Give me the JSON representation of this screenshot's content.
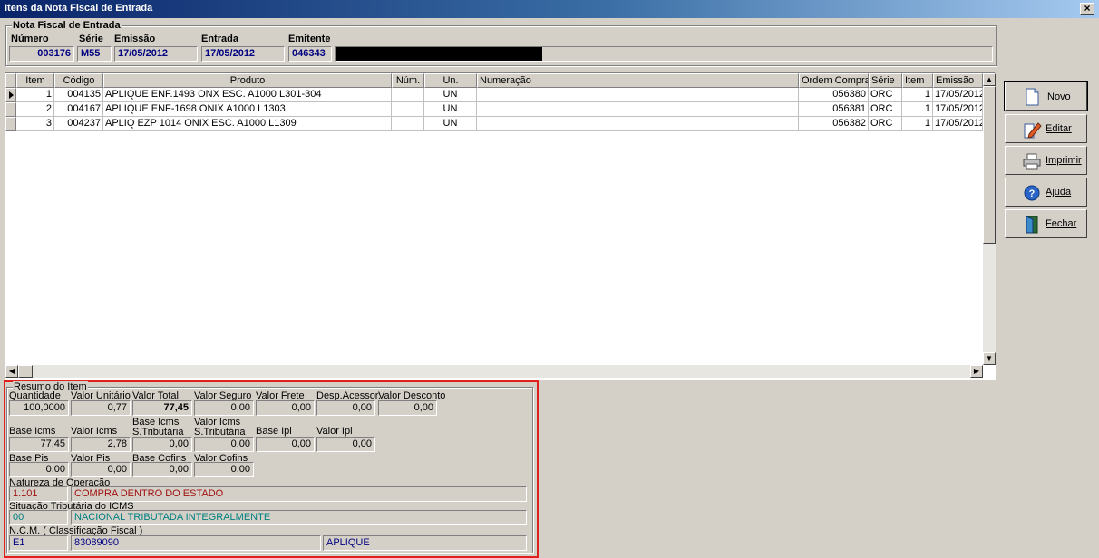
{
  "window": {
    "title": "Itens da Nota Fiscal de Entrada",
    "close_glyph": "×"
  },
  "nf": {
    "group_title": "Nota Fiscal de Entrada",
    "labels": {
      "numero": "Número",
      "serie": "Série",
      "emissao": "Emissão",
      "entrada": "Entrada",
      "emitente": "Emitente"
    },
    "values": {
      "numero": "003176",
      "serie": "M55",
      "emissao": "17/05/2012",
      "entrada": "17/05/2012",
      "emitente": "046343"
    }
  },
  "grid": {
    "columns": [
      "Item",
      "Código",
      "Produto",
      "Núm.",
      "Un.",
      "Numeração",
      "Ordem Compra",
      "Série",
      "Item",
      "Emissão"
    ],
    "rows": [
      {
        "item": "1",
        "codigo": "004135",
        "produto": "APLIQUE ENF.1493 ONX ESC. A1000 L301-304",
        "num": "",
        "un": "UN",
        "numeracao": "",
        "ordem": "056380",
        "serie": "ORC",
        "item2": "1",
        "emissao": "17/05/2012"
      },
      {
        "item": "2",
        "codigo": "004167",
        "produto": "APLIQUE ENF-1698 ONIX A1000 L1303",
        "num": "",
        "un": "UN",
        "numeracao": "",
        "ordem": "056381",
        "serie": "ORC",
        "item2": "1",
        "emissao": "17/05/2012"
      },
      {
        "item": "3",
        "codigo": "004237",
        "produto": "APLIQ EZP 1014 ONIX ESC. A1000 L1309",
        "num": "",
        "un": "UN",
        "numeracao": "",
        "ordem": "056382",
        "serie": "ORC",
        "item2": "1",
        "emissao": "17/05/2012"
      }
    ]
  },
  "buttons": {
    "novo": "Novo",
    "editar": "Editar",
    "imprimir": "Imprimir",
    "ajuda": "Ajuda",
    "fechar": "Fechar"
  },
  "resumo": {
    "title": "Resumo do Item",
    "quantidade": {
      "label": "Quantidade",
      "value": "100,0000"
    },
    "valor_unitario": {
      "label": "Valor Unitário",
      "value": "0,77"
    },
    "valor_total": {
      "label": "Valor Total",
      "value": "77,45"
    },
    "valor_seguro": {
      "label": "Valor Seguro",
      "value": "0,00"
    },
    "valor_frete": {
      "label": "Valor Frete",
      "value": "0,00"
    },
    "desp_acessor": {
      "label": "Desp.Acessor.",
      "value": "0,00"
    },
    "valor_desconto": {
      "label": "Valor Desconto",
      "value": "0,00"
    },
    "base_icms": {
      "label": "Base Icms",
      "value": "77,45"
    },
    "valor_icms": {
      "label": "Valor Icms",
      "value": "2,78"
    },
    "base_icms_st": {
      "label1": "Base Icms",
      "label2": "S.Tributária",
      "value": "0,00"
    },
    "valor_icms_st": {
      "label1": "Valor Icms",
      "label2": "S.Tributária",
      "value": "0,00"
    },
    "base_ipi": {
      "label": "Base Ipi",
      "value": "0,00"
    },
    "valor_ipi": {
      "label": "Valor Ipi",
      "value": "0,00"
    },
    "base_pis": {
      "label": "Base Pis",
      "value": "0,00"
    },
    "valor_pis": {
      "label": "Valor Pis",
      "value": "0,00"
    },
    "base_cofins": {
      "label": "Base Cofins",
      "value": "0,00"
    },
    "valor_cofins": {
      "label": "Valor Cofins",
      "value": "0,00"
    },
    "natureza": {
      "label": "Natureza de Operação",
      "code": "1.101",
      "desc": "COMPRA DENTRO DO ESTADO"
    },
    "situacao": {
      "label": "Situação Tributária do ICMS",
      "code": "00",
      "desc": "NACIONAL TRIBUTADA INTEGRALMENTE"
    },
    "ncm": {
      "label": "N.C.M. ( Classificação Fiscal )",
      "code": "E1",
      "number": "83089090",
      "desc": "APLIQUE"
    }
  }
}
